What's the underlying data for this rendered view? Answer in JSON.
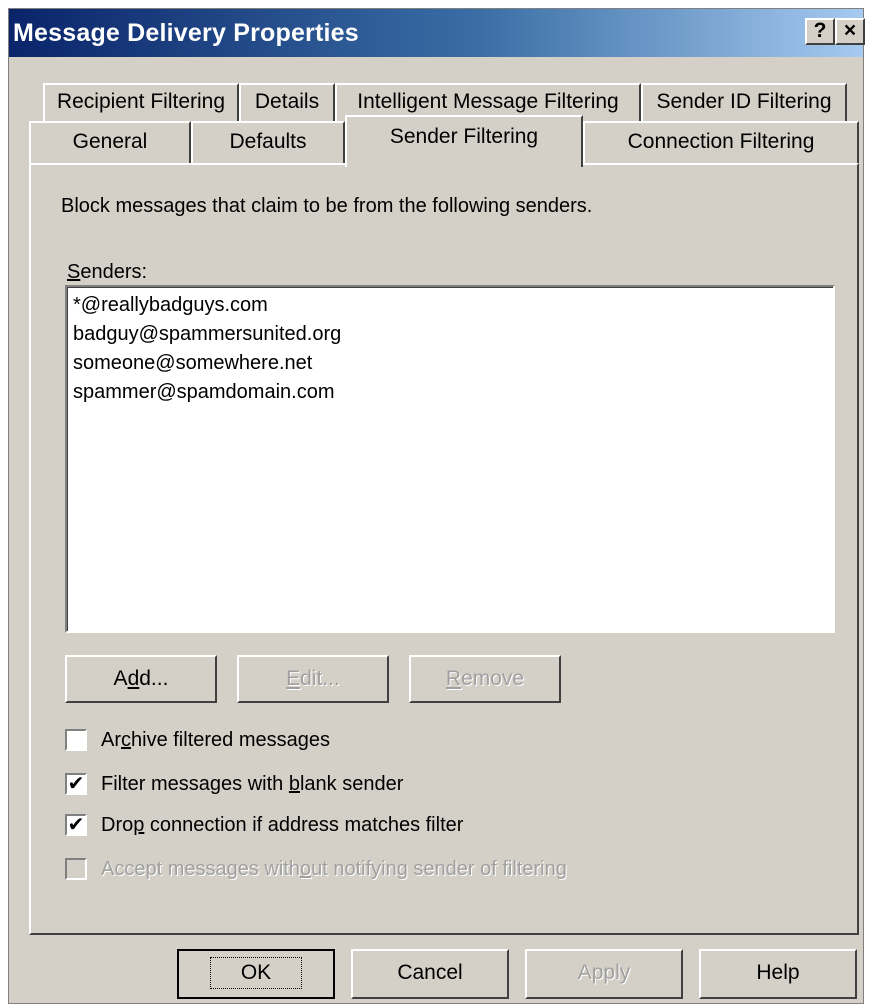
{
  "window": {
    "title": "Message Delivery Properties",
    "help_glyph": "?",
    "close_glyph": "×"
  },
  "tabs": {
    "row1": [
      "Recipient Filtering",
      "Details",
      "Intelligent Message Filtering",
      "Sender ID Filtering"
    ],
    "row2": [
      "General",
      "Defaults",
      "Sender Filtering",
      "Connection Filtering"
    ],
    "active": "Sender Filtering"
  },
  "panel": {
    "description": "Block messages that claim to be from the following senders.",
    "senders_label_accel": "S",
    "senders_label_rest": "enders:",
    "senders": [
      "*@reallybadguys.com",
      "badguy@spammersunited.org",
      "someone@somewhere.net",
      "spammer@spamdomain.com"
    ],
    "buttons": {
      "add": {
        "pre": "A",
        "accel": "d",
        "post": "d...",
        "enabled": true
      },
      "edit": {
        "pre": "",
        "accel": "E",
        "post": "dit...",
        "enabled": false
      },
      "remove": {
        "pre": "",
        "accel": "R",
        "post": "emove",
        "enabled": false
      }
    },
    "checkboxes": [
      {
        "pre": "Ar",
        "accel": "c",
        "post": "hive filtered messages",
        "checked": false,
        "enabled": true
      },
      {
        "pre": "Filter messages with ",
        "accel": "b",
        "post": "lank sender",
        "checked": true,
        "enabled": true
      },
      {
        "pre": "Dro",
        "accel": "p",
        "post": " connection if address matches filter",
        "checked": true,
        "enabled": true
      },
      {
        "pre": "Accept messages with",
        "accel": "o",
        "post": "ut notifying sender of filtering",
        "checked": false,
        "enabled": false
      }
    ]
  },
  "footer": {
    "ok": "OK",
    "cancel": "Cancel",
    "apply": "Apply",
    "help": "Help"
  },
  "colors": {
    "face": "#d4d0c8",
    "title_start": "#0a246a",
    "title_end": "#a6caf0",
    "disabled_text": "#a0a0a0"
  }
}
